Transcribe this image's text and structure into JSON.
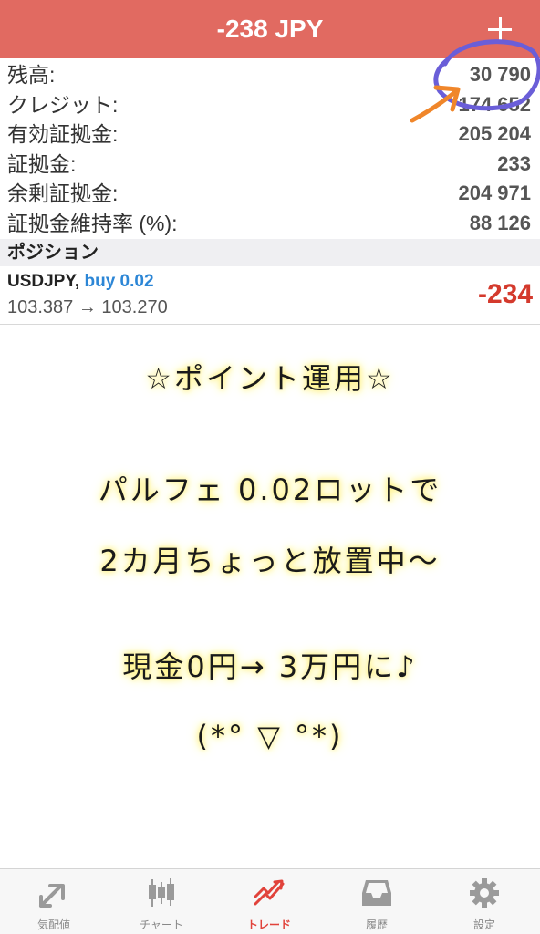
{
  "header": {
    "title": "-238 JPY"
  },
  "summary": [
    {
      "label": "残高:",
      "value": "30 790"
    },
    {
      "label": "クレジット:",
      "value": "174 652"
    },
    {
      "label": "有効証拠金:",
      "value": "205 204"
    },
    {
      "label": "証拠金:",
      "value": "233"
    },
    {
      "label": "余剰証拠金:",
      "value": "204 971"
    },
    {
      "label": "証拠金維持率 (%):",
      "value": "88 126"
    }
  ],
  "positions_header": "ポジション",
  "position": {
    "symbol": "USDJPY,",
    "side": "buy 0.02",
    "prices": "103.387 → 103.270",
    "profit": "-234"
  },
  "note": [
    "☆ポイント運用☆",
    "パルフェ 0.02ロットで",
    "2カ月ちょっと放置中〜",
    "現金0円→ 3万円に♪",
    "(*° ▽ °*)"
  ],
  "tabs": [
    {
      "label": "気配値",
      "icon": "quotes-icon"
    },
    {
      "label": "チャート",
      "icon": "chart-icon"
    },
    {
      "label": "トレード",
      "icon": "trade-icon",
      "active": true
    },
    {
      "label": "履歴",
      "icon": "history-icon"
    },
    {
      "label": "設定",
      "icon": "settings-icon"
    }
  ],
  "colors": {
    "header": "#e16a61",
    "accent_red": "#d43a2d",
    "buy_blue": "#2c86d6",
    "highlight": "#fff06a"
  }
}
